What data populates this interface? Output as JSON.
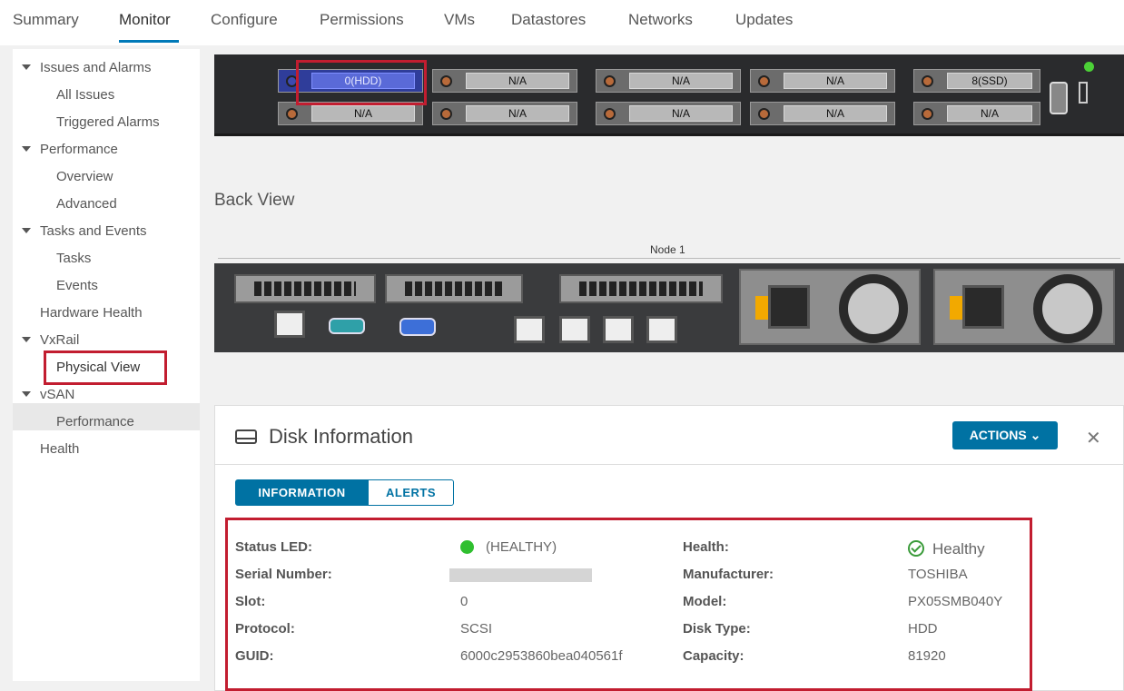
{
  "tabs": [
    {
      "label": "Summary"
    },
    {
      "label": "Monitor"
    },
    {
      "label": "Configure"
    },
    {
      "label": "Permissions"
    },
    {
      "label": "VMs"
    },
    {
      "label": "Datastores"
    },
    {
      "label": "Networks"
    },
    {
      "label": "Updates"
    }
  ],
  "active_tab": "Monitor",
  "sidebar": {
    "items": [
      {
        "label": "Issues and Alarms"
      },
      {
        "label": "All Issues"
      },
      {
        "label": "Triggered Alarms"
      },
      {
        "label": "Performance"
      },
      {
        "label": "Overview"
      },
      {
        "label": "Advanced"
      },
      {
        "label": "Tasks and Events"
      },
      {
        "label": "Tasks"
      },
      {
        "label": "Events"
      },
      {
        "label": "Hardware Health"
      },
      {
        "label": "VxRail"
      },
      {
        "label": "Physical View"
      },
      {
        "label": "vSAN"
      },
      {
        "label": "Performance"
      },
      {
        "label": "Health"
      }
    ],
    "selected": "Physical View"
  },
  "front_view": {
    "slots_top": [
      "0(HDD)",
      "N/A",
      "N/A",
      "N/A",
      "8(SSD)"
    ],
    "slots_bottom": [
      "N/A",
      "N/A",
      "N/A",
      "N/A",
      "N/A"
    ],
    "selected_slot": "0(HDD)"
  },
  "back_view": {
    "title": "Back View",
    "node_label": "Node 1"
  },
  "disk_panel": {
    "title": "Disk Information",
    "actions_label": "ACTIONS ⌄",
    "close_label": "✕",
    "tabs": [
      {
        "label": "INFORMATION"
      },
      {
        "label": "ALERTS"
      }
    ],
    "active_tab": "INFORMATION",
    "fields_left": [
      {
        "label": "Status LED:",
        "value": "(HEALTHY)"
      },
      {
        "label": "Serial Number:",
        "value": ""
      },
      {
        "label": "Slot:",
        "value": "0"
      },
      {
        "label": "Protocol:",
        "value": "SCSI"
      },
      {
        "label": "GUID:",
        "value": "6000c2953860bea040561f"
      }
    ],
    "fields_right": [
      {
        "label": "Health:",
        "value": "Healthy"
      },
      {
        "label": "Manufacturer:",
        "value": "TOSHIBA"
      },
      {
        "label": "Model:",
        "value": "PX05SMB040Y"
      },
      {
        "label": "Disk Type:",
        "value": "HDD"
      },
      {
        "label": "Capacity:",
        "value": "81920"
      }
    ]
  },
  "colors": {
    "accent": "#0072a3",
    "highlight_border": "#c21d30",
    "status_led": "#2fbf2f",
    "healthy_check": "#3a9b3a"
  },
  "icons": {
    "disk": "hard-drive-icon",
    "health": "check-circle-icon",
    "close": "close-icon",
    "caret": "caret-down-icon"
  }
}
